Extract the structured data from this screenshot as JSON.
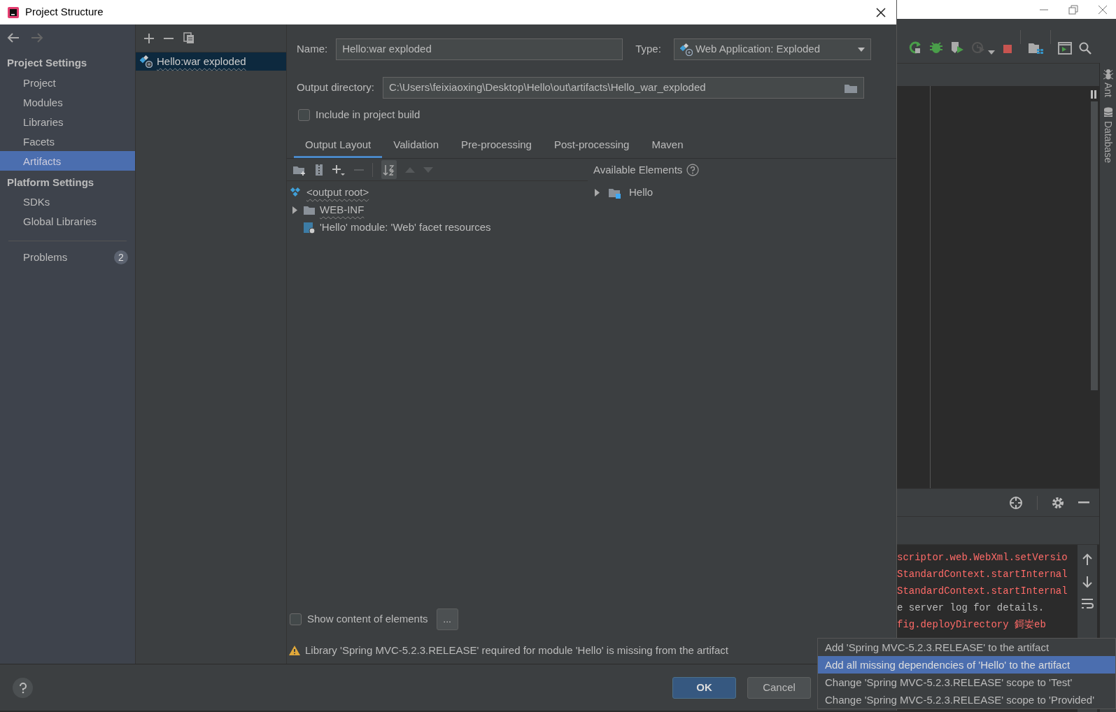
{
  "dialog": {
    "title": "Project Structure"
  },
  "sidebar": {
    "sections": [
      {
        "heading": "Project Settings",
        "items": [
          {
            "label": "Project",
            "selected": false
          },
          {
            "label": "Modules",
            "selected": false
          },
          {
            "label": "Libraries",
            "selected": false
          },
          {
            "label": "Facets",
            "selected": false
          },
          {
            "label": "Artifacts",
            "selected": true
          }
        ]
      },
      {
        "heading": "Platform Settings",
        "items": [
          {
            "label": "SDKs",
            "selected": false
          },
          {
            "label": "Global Libraries",
            "selected": false
          }
        ]
      }
    ],
    "problems": {
      "label": "Problems",
      "count": "2"
    }
  },
  "artifacts": [
    {
      "label": "Hello:war exploded",
      "selected": true
    }
  ],
  "form": {
    "name_label": "Name:",
    "name_value": "Hello:war exploded",
    "type_label": "Type:",
    "type_value": "Web Application: Exploded",
    "output_label": "Output directory:",
    "output_value": "C:\\Users\\feixiaoxing\\Desktop\\Hello\\out\\artifacts\\Hello_war_exploded",
    "include_build": {
      "label": "Include in project build",
      "checked": false
    }
  },
  "tabs": [
    {
      "label": "Output Layout",
      "selected": true
    },
    {
      "label": "Validation",
      "selected": false
    },
    {
      "label": "Pre-processing",
      "selected": false
    },
    {
      "label": "Post-processing",
      "selected": false
    },
    {
      "label": "Maven",
      "selected": false
    }
  ],
  "layout_tree": [
    {
      "label": "<output root>",
      "kind": "root",
      "children": [
        {
          "label": "WEB-INF",
          "kind": "folder",
          "expanded": false
        },
        {
          "label": "'Hello' module: 'Web' facet resources",
          "kind": "facet"
        }
      ]
    }
  ],
  "available": {
    "title": "Available Elements",
    "items": [
      {
        "label": "Hello",
        "expanded": false
      }
    ]
  },
  "show_content": {
    "label": "Show content of elements",
    "checked": false
  },
  "more_button": "...",
  "warning": "Library 'Spring MVC-5.2.3.RELEASE' required for module 'Hello' is missing from the artifact",
  "buttons": [
    {
      "label": "OK",
      "kind": "primary"
    },
    {
      "label": "Cancel",
      "kind": "secondary"
    }
  ],
  "ide": {
    "side_tools": [
      "Ant",
      "Database"
    ],
    "console_lines": [
      {
        "text": "scriptor.web.WebXml.setVersio",
        "kind": "error"
      },
      {
        "text": "StandardContext.startInternal",
        "kind": "error"
      },
      {
        "text": "StandardContext.startInternal",
        "kind": "error"
      },
      {
        "text": "e server log for details.",
        "kind": "info"
      },
      {
        "text": "fig.deployDirectory 鎶妛eb",
        "kind": "error"
      }
    ]
  },
  "quickfix_menu": [
    {
      "label": "Add 'Spring MVC-5.2.3.RELEASE' to the artifact",
      "selected": false
    },
    {
      "label": "Add all missing dependencies of 'Hello' to the artifact",
      "selected": true
    },
    {
      "label": "Change 'Spring MVC-5.2.3.RELEASE' scope to 'Test'",
      "selected": false
    },
    {
      "label": "Change 'Spring MVC-5.2.3.RELEASE' scope to 'Provided'",
      "selected": false
    }
  ]
}
